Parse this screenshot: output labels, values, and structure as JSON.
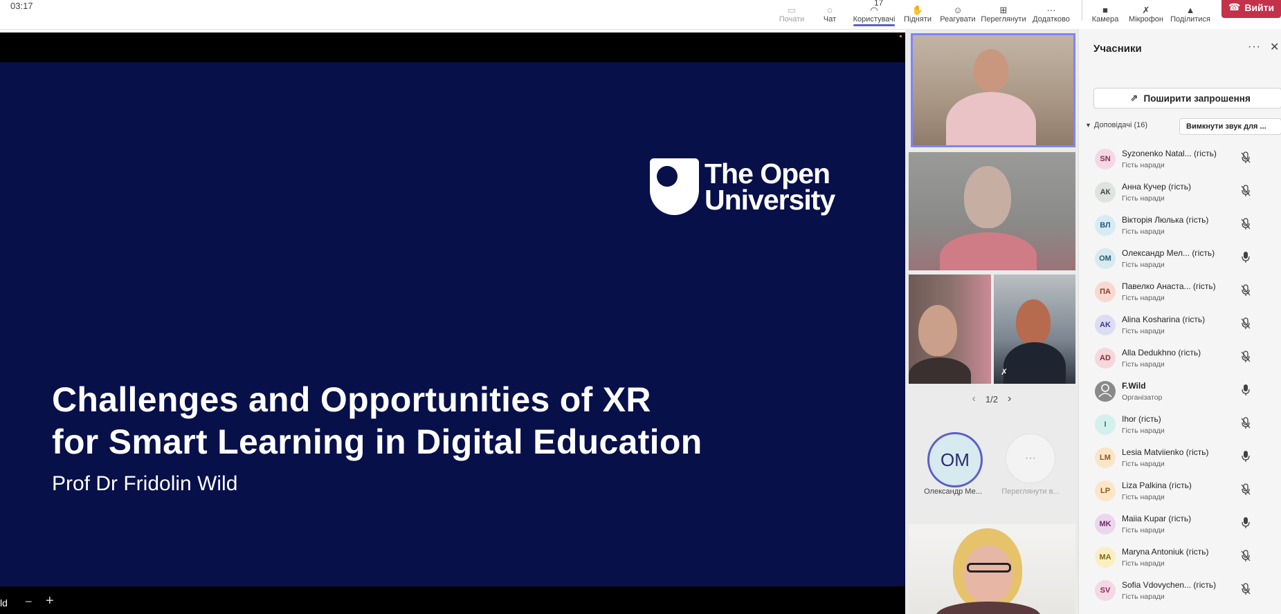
{
  "topbar": {
    "timer": "03:17",
    "buttons": [
      {
        "label": "Почати",
        "icon": "record-icon"
      },
      {
        "label": "Чат",
        "icon": "chat-icon"
      },
      {
        "label": "Користувачі",
        "icon": "people-icon",
        "count": "17"
      },
      {
        "label": "Підняти",
        "icon": "raise-hand-icon"
      },
      {
        "label": "Реагувати",
        "icon": "emoji-icon"
      },
      {
        "label": "Переглянути",
        "icon": "view-grid-icon"
      },
      {
        "label": "Додатково",
        "icon": "more-icon"
      },
      {
        "label": "Камера",
        "icon": "camera-icon"
      },
      {
        "label": "Мікрофон",
        "icon": "microphone-muted-icon"
      },
      {
        "label": "Поділитися",
        "icon": "share-icon"
      }
    ],
    "leave_label": "Вийти",
    "leave_color": "#c4314b",
    "accent_color": "#5b5fc7"
  },
  "slide": {
    "logo_line1": "The Open",
    "logo_line2": "University",
    "title_line1": "Challenges and Opportunities of XR",
    "title_line2": "for Smart Learning in Digital Education",
    "subtitle": "Prof Dr Fridolin Wild",
    "background_color": "#08104a",
    "bottom_name": "ld",
    "zoom_out_symbol": "−",
    "zoom_in_symbol": "+"
  },
  "video": {
    "pager": "1/2",
    "avatars": [
      {
        "initials": "OM",
        "caption": "Олександр Ме..."
      },
      {
        "initials": "···",
        "caption": "Переглянути в..."
      }
    ]
  },
  "panel": {
    "title": "Учасники",
    "invite_label": "Поширити запрошення",
    "group_label": "Доповідачі (16)",
    "mute_all_label": "Вимкнути звук для ...",
    "participants": [
      {
        "initials": "SN",
        "name": "Syzonenko Natal... (гість)",
        "role": "Гість наради",
        "mic": "off",
        "color": "#f4d8e4",
        "text_color": "#8a2a5a"
      },
      {
        "initials": "АК",
        "name": "Анна Кучер (гість)",
        "role": "Гість наради",
        "mic": "off",
        "color": "#dfe3e0",
        "text_color": "#3a4a40"
      },
      {
        "initials": "ВЛ",
        "name": "Вікторія Люлька (гість)",
        "role": "Гість наради",
        "mic": "off",
        "color": "#d7ebf4",
        "text_color": "#2a5a7a"
      },
      {
        "initials": "ОМ",
        "name": "Олександр Мел... (гість)",
        "role": "Гість наради",
        "mic": "on",
        "color": "#d6eaf0",
        "text_color": "#2a5a6a"
      },
      {
        "initials": "ПА",
        "name": "Павелко Анаста... (гість)",
        "role": "Гість наради",
        "mic": "off",
        "color": "#f8d9d0",
        "text_color": "#8a3a2a"
      },
      {
        "initials": "AK",
        "name": "Alina Kosharina (гість)",
        "role": "Гість наради",
        "mic": "off",
        "color": "#dcdcf5",
        "text_color": "#3a3a8a"
      },
      {
        "initials": "AD",
        "name": "Alla Dedukhno (гість)",
        "role": "Гість наради",
        "mic": "off",
        "color": "#f6d7dc",
        "text_color": "#8a2a3a"
      },
      {
        "initials": "",
        "name": "F.Wild",
        "role": "Організатор",
        "mic": "on",
        "color": "#8a8a8a",
        "text_color": "#ffffff",
        "bold": true
      },
      {
        "initials": "I",
        "name": "Ihor (гість)",
        "role": "Гість наради",
        "mic": "off",
        "color": "#d4f0ec",
        "text_color": "#2a7a6a"
      },
      {
        "initials": "LM",
        "name": "Lesia Matviienko (гість)",
        "role": "Гість наради",
        "mic": "on",
        "color": "#fbe5c8",
        "text_color": "#8a5a1a"
      },
      {
        "initials": "LP",
        "name": "Liza Palkina (гість)",
        "role": "Гість наради",
        "mic": "off",
        "color": "#fbe6c8",
        "text_color": "#8a5a1a"
      },
      {
        "initials": "MK",
        "name": "Maiia Kupar (гість)",
        "role": "Гість наради",
        "mic": "on",
        "color": "#ecd6ec",
        "text_color": "#6a2a6a"
      },
      {
        "initials": "MA",
        "name": "Maryna Antoniuk (гість)",
        "role": "Гість наради",
        "mic": "off",
        "color": "#fbeec0",
        "text_color": "#7a6a1a"
      },
      {
        "initials": "SV",
        "name": "Sofia Vdovychen... (гість)",
        "role": "Гість наради",
        "mic": "off",
        "color": "#f4d8e4",
        "text_color": "#8a2a5a"
      }
    ]
  }
}
